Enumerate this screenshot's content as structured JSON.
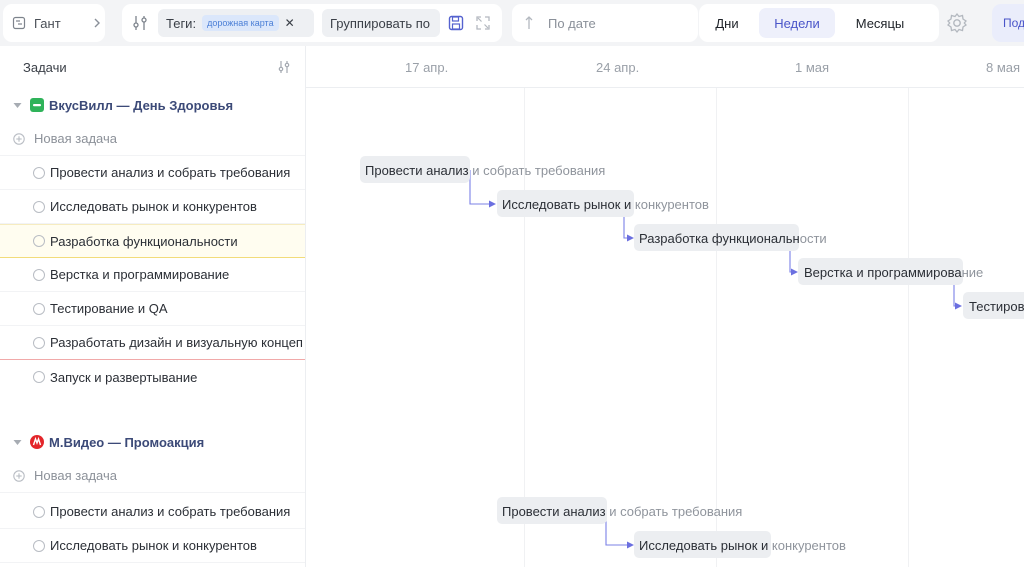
{
  "toolbar": {
    "view_label": "Гант",
    "tags_label": "Теги:",
    "tag_badge": "дорожная карта",
    "group_label": "Группировать по",
    "sort_label": "По дате",
    "scale_days": "Дни",
    "scale_weeks": "Недели",
    "scale_months": "Месяцы",
    "cut_button": "Под"
  },
  "tasks_header": "Задачи",
  "timeline": {
    "dates": [
      "17 апр.",
      "24 апр.",
      "1 мая",
      "8 мая"
    ]
  },
  "groups": [
    {
      "title": "ВкусВилл — День Здоровья",
      "new_task": "Новая задача",
      "tasks": [
        "Провести анализ и собрать требования",
        "Исследовать рынок и конкурентов",
        "Разработка функциональности",
        "Верстка и программирование",
        "Тестирование и QA",
        "Разработать дизайн и визуальную концеп",
        "Запуск и развертывание"
      ]
    },
    {
      "title": "М.Видео — Промоакция",
      "new_task": "Новая задача",
      "tasks": [
        "Провести анализ и собрать требования",
        "Исследовать рынок и конкурентов"
      ]
    }
  ],
  "bars": [
    {
      "dark": "Провести анализ",
      "light": " и собрать требования"
    },
    {
      "dark": "Исследовать рынок и",
      "light": " конкурентов"
    },
    {
      "dark": "Разработка функциональн",
      "light": "ости"
    },
    {
      "dark": "Верстка и программирова",
      "light": "ние"
    },
    {
      "dark": "Тестиров",
      "light": ""
    },
    {
      "dark": "Провести анализ",
      "light": " и собрать требования"
    },
    {
      "dark": "Исследовать рынок и",
      "light": " конкурентов"
    }
  ],
  "colors": {
    "accent": "#4a55c9",
    "arrow": "#6b6fe0",
    "group1_icon": "#2fb35a",
    "group2_icon": "#e3262b"
  }
}
